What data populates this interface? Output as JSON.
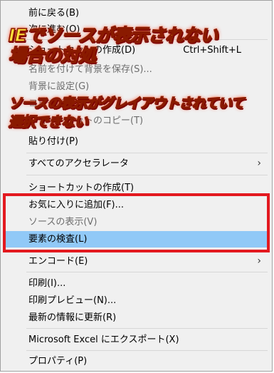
{
  "menu": {
    "items": [
      {
        "label": "前に戻る(B)",
        "shortcut": "",
        "disabled": false,
        "highlight": false,
        "submenu": false
      },
      {
        "label": "次に進む(O)",
        "shortcut": "",
        "disabled": false,
        "highlight": false,
        "submenu": false
      },
      {
        "label": "ショートカットの作成(D)",
        "shortcut": "Ctrl+Shift+L",
        "disabled": false,
        "highlight": false,
        "submenu": false
      },
      {
        "label": "名前を付けて背景を保存(S)...",
        "shortcut": "",
        "disabled": true,
        "highlight": false,
        "submenu": false
      },
      {
        "label": "背景に設定(G)",
        "shortcut": "",
        "disabled": true,
        "highlight": false,
        "submenu": false
      },
      {
        "label": "コピー(C)",
        "shortcut": "",
        "disabled": true,
        "highlight": false,
        "submenu": false
      },
      {
        "label": "ショートカットのコピー(T)",
        "shortcut": "",
        "disabled": true,
        "highlight": false,
        "submenu": false
      },
      {
        "label": "貼り付け(P)",
        "shortcut": "",
        "disabled": false,
        "highlight": false,
        "submenu": false
      },
      {
        "label": "すべてのアクセラレータ",
        "shortcut": "",
        "disabled": false,
        "highlight": false,
        "submenu": true
      },
      {
        "label": "ショートカットの作成(T)",
        "shortcut": "",
        "disabled": false,
        "highlight": false,
        "submenu": false
      },
      {
        "label": "お気に入りに追加(F)...",
        "shortcut": "",
        "disabled": false,
        "highlight": false,
        "submenu": false
      },
      {
        "label": "ソースの表示(V)",
        "shortcut": "",
        "disabled": true,
        "highlight": false,
        "submenu": false
      },
      {
        "label": "要素の検査(L)",
        "shortcut": "",
        "disabled": false,
        "highlight": true,
        "submenu": false
      },
      {
        "label": "エンコード(E)",
        "shortcut": "",
        "disabled": false,
        "highlight": false,
        "submenu": true
      },
      {
        "label": "印刷(I)...",
        "shortcut": "",
        "disabled": false,
        "highlight": false,
        "submenu": false
      },
      {
        "label": "印刷プレビュー(N)...",
        "shortcut": "",
        "disabled": false,
        "highlight": false,
        "submenu": false
      },
      {
        "label": "最新の情報に更新(R)",
        "shortcut": "",
        "disabled": false,
        "highlight": false,
        "submenu": false
      },
      {
        "label": "Microsoft Excel にエクスポート(X)",
        "shortcut": "",
        "disabled": false,
        "highlight": false,
        "submenu": false
      },
      {
        "label": "プロパティ(P)",
        "shortcut": "",
        "disabled": false,
        "highlight": false,
        "submenu": false
      }
    ],
    "submenu_arrow": "›"
  },
  "annotations": {
    "callout_1_line1": "IEでソースが表示されない",
    "callout_1_line2": "場合の対処",
    "callout_2_line1": "ソースの表示がグレイアウトされていて",
    "callout_2_line2": "選択できない"
  },
  "colors": {
    "highlight": "#91c9f7",
    "disabled_text": "#6d6d6d",
    "annotation_box": "#e3191f",
    "callout_fill": "#ffe23c",
    "callout_outline": "#8a1a00"
  },
  "icons": {
    "submenu": "chevron-right-icon"
  }
}
